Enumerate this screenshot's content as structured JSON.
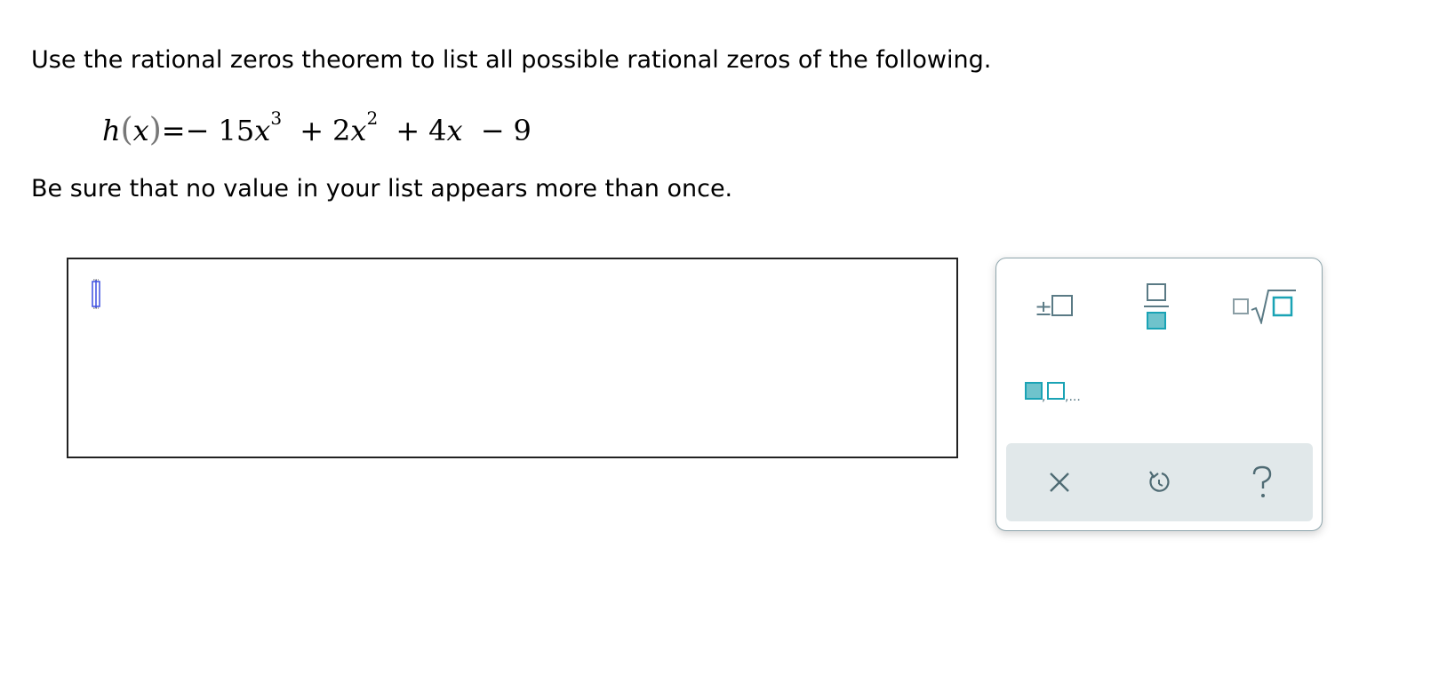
{
  "question": {
    "prompt": "Use the rational zeros theorem to list all possible rational zeros of the following.",
    "note": "Be sure that no value in your list appears more than once."
  },
  "equation": {
    "fn": "h",
    "var": "x",
    "equals": "=",
    "neg_sign": "−",
    "term1_coef": "15",
    "term1_exp": "3",
    "op2": "+",
    "term2_coef": "2",
    "term2_exp": "2",
    "op3": "+",
    "term3_coef": "4",
    "op4": "−",
    "constant": "9"
  },
  "keypad": {
    "keys": [
      "plus-minus-icon",
      "fraction-icon",
      "nth-root-icon",
      "list-icon"
    ],
    "list_ellipsis": ",...",
    "plus_minus": "±",
    "actions": [
      "clear-icon",
      "undo-icon",
      "help-icon"
    ],
    "accent_color": "#1aa3b5",
    "outline_color": "#5a7a85"
  }
}
